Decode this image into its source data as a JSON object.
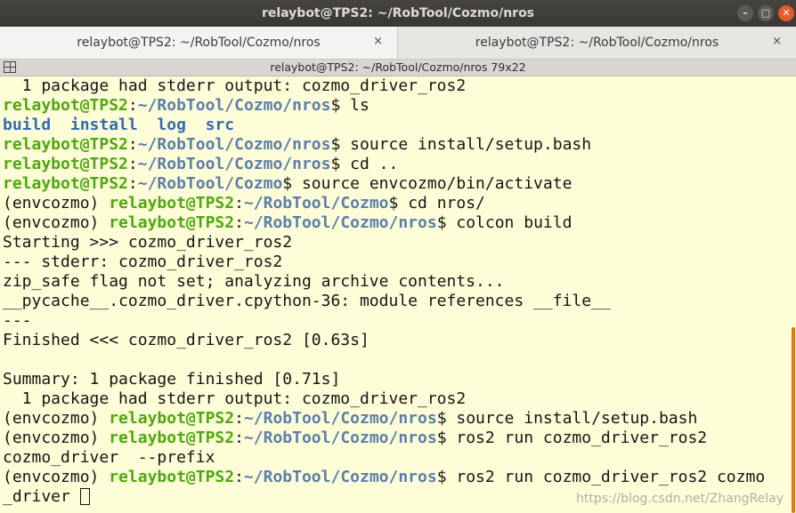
{
  "window": {
    "title": "relaybot@TPS2: ~/RobTool/Cozmo/nros",
    "buttons": {
      "minimize": "–",
      "maximize": "□",
      "close": "✕"
    }
  },
  "tabs": [
    {
      "label": "relaybot@TPS2: ~/RobTool/Cozmo/nros",
      "close": "×",
      "active": true
    },
    {
      "label": "relaybot@TPS2: ~/RobTool/Cozmo/nros",
      "close": "×",
      "active": false
    }
  ],
  "terminal_header": {
    "title": "relaybot@TPS2: ~/RobTool/Cozmo/nros 79x22",
    "icon": "expand-icon"
  },
  "colors": {
    "background": "#fdfdd8",
    "user_host": "#4ea80f",
    "path": "#5a7eab",
    "directory": "#356bb3",
    "scrollbar": "#e9721c"
  },
  "lines": [
    {
      "text": "  1 package had stderr output: cozmo_driver_ros2"
    },
    {
      "user": "relaybot@TPS2",
      "sep": ":",
      "path": "~/RobTool/Cozmo/nros",
      "cmd": "$ ls"
    },
    {
      "dirs": [
        "build",
        "install",
        "log",
        "src"
      ]
    },
    {
      "user": "relaybot@TPS2",
      "sep": ":",
      "path": "~/RobTool/Cozmo/nros",
      "cmd": "$ source install/setup.bash"
    },
    {
      "user": "relaybot@TPS2",
      "sep": ":",
      "path": "~/RobTool/Cozmo/nros",
      "cmd": "$ cd .."
    },
    {
      "user": "relaybot@TPS2",
      "sep": ":",
      "path": "~/RobTool/Cozmo",
      "cmd": "$ source envcozmo/bin/activate"
    },
    {
      "prefix": "(envcozmo) ",
      "user": "relaybot@TPS2",
      "sep": ":",
      "path": "~/RobTool/Cozmo",
      "cmd": "$ cd nros/"
    },
    {
      "prefix": "(envcozmo) ",
      "user": "relaybot@TPS2",
      "sep": ":",
      "path": "~/RobTool/Cozmo/nros",
      "cmd": "$ colcon build"
    },
    {
      "text": "Starting >>> cozmo_driver_ros2"
    },
    {
      "text": "--- stderr: cozmo_driver_ros2"
    },
    {
      "text": "zip_safe flag not set; analyzing archive contents..."
    },
    {
      "text": "__pycache__.cozmo_driver.cpython-36: module references __file__"
    },
    {
      "text": "---"
    },
    {
      "text": "Finished <<< cozmo_driver_ros2 [0.63s]"
    },
    {
      "text": ""
    },
    {
      "text": "Summary: 1 package finished [0.71s]"
    },
    {
      "text": "  1 package had stderr output: cozmo_driver_ros2"
    },
    {
      "prefix": "(envcozmo) ",
      "user": "relaybot@TPS2",
      "sep": ":",
      "path": "~/RobTool/Cozmo/nros",
      "cmd": "$ source install/setup.bash"
    },
    {
      "prefix": "(envcozmo) ",
      "user": "relaybot@TPS2",
      "sep": ":",
      "path": "~/RobTool/Cozmo/nros",
      "cmd": "$ ros2 run cozmo_driver_ros2"
    },
    {
      "text": "cozmo_driver  --prefix"
    },
    {
      "prefix": "(envcozmo) ",
      "user": "relaybot@TPS2",
      "sep": ":",
      "path": "~/RobTool/Cozmo/nros",
      "cmd": "$ ros2 run cozmo_driver_ros2 cozmo"
    },
    {
      "text": "_driver ",
      "cursor": true
    }
  ],
  "watermark": "https://blog.csdn.net/ZhangRelay"
}
